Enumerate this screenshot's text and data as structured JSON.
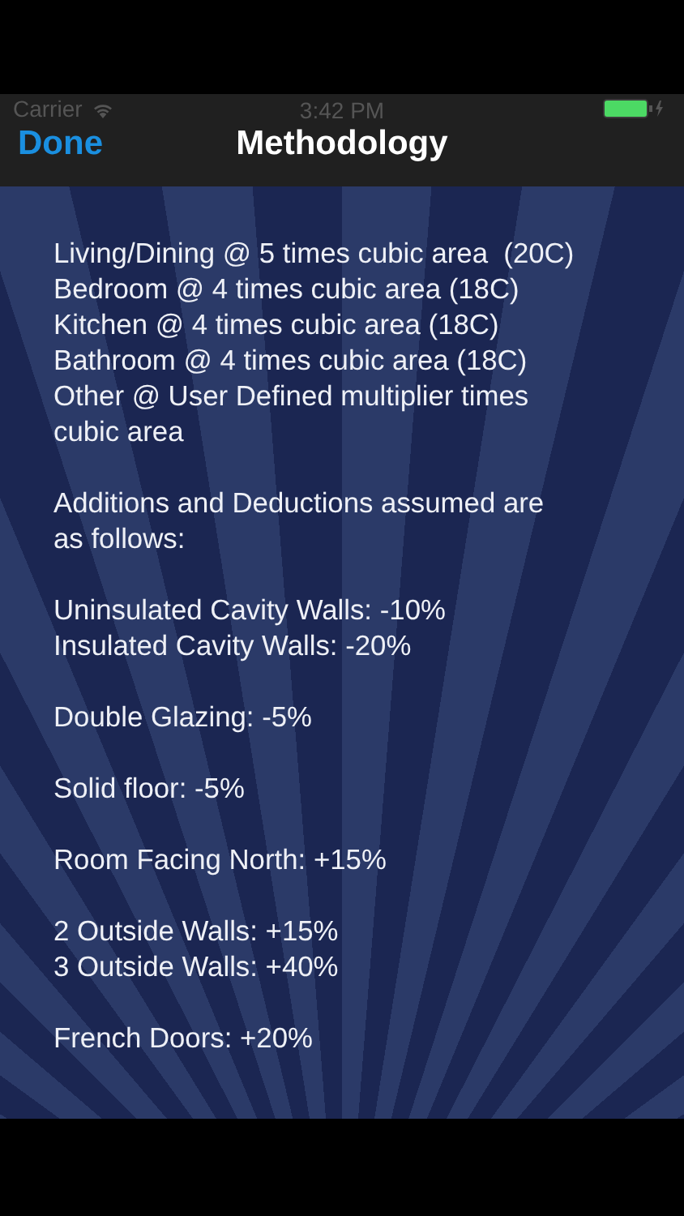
{
  "status_bar": {
    "carrier": "Carrier",
    "time": "3:42 PM"
  },
  "nav_bar": {
    "left_button": "Done",
    "title": "Methodology"
  },
  "groups": [
    [
      "Living/Dining @ 5 times cubic area  (20C)",
      "Bedroom @ 4 times cubic area (18C)",
      "Kitchen @ 4 times cubic area (18C)",
      "Bathroom @ 4 times cubic area (18C)",
      "Other @ User Defined multiplier times cubic area"
    ],
    [
      "Additions and Deductions assumed are as follows:"
    ],
    [
      "Uninsulated Cavity Walls: -10%",
      "Insulated Cavity Walls: -20%"
    ],
    [
      "Double Glazing: -5%"
    ],
    [
      "Solid floor: -5%"
    ],
    [
      "Room Facing North: +15%"
    ],
    [
      "2 Outside Walls: +15%",
      "3 Outside Walls: +40%"
    ],
    [
      "French Doors: +20%"
    ]
  ]
}
